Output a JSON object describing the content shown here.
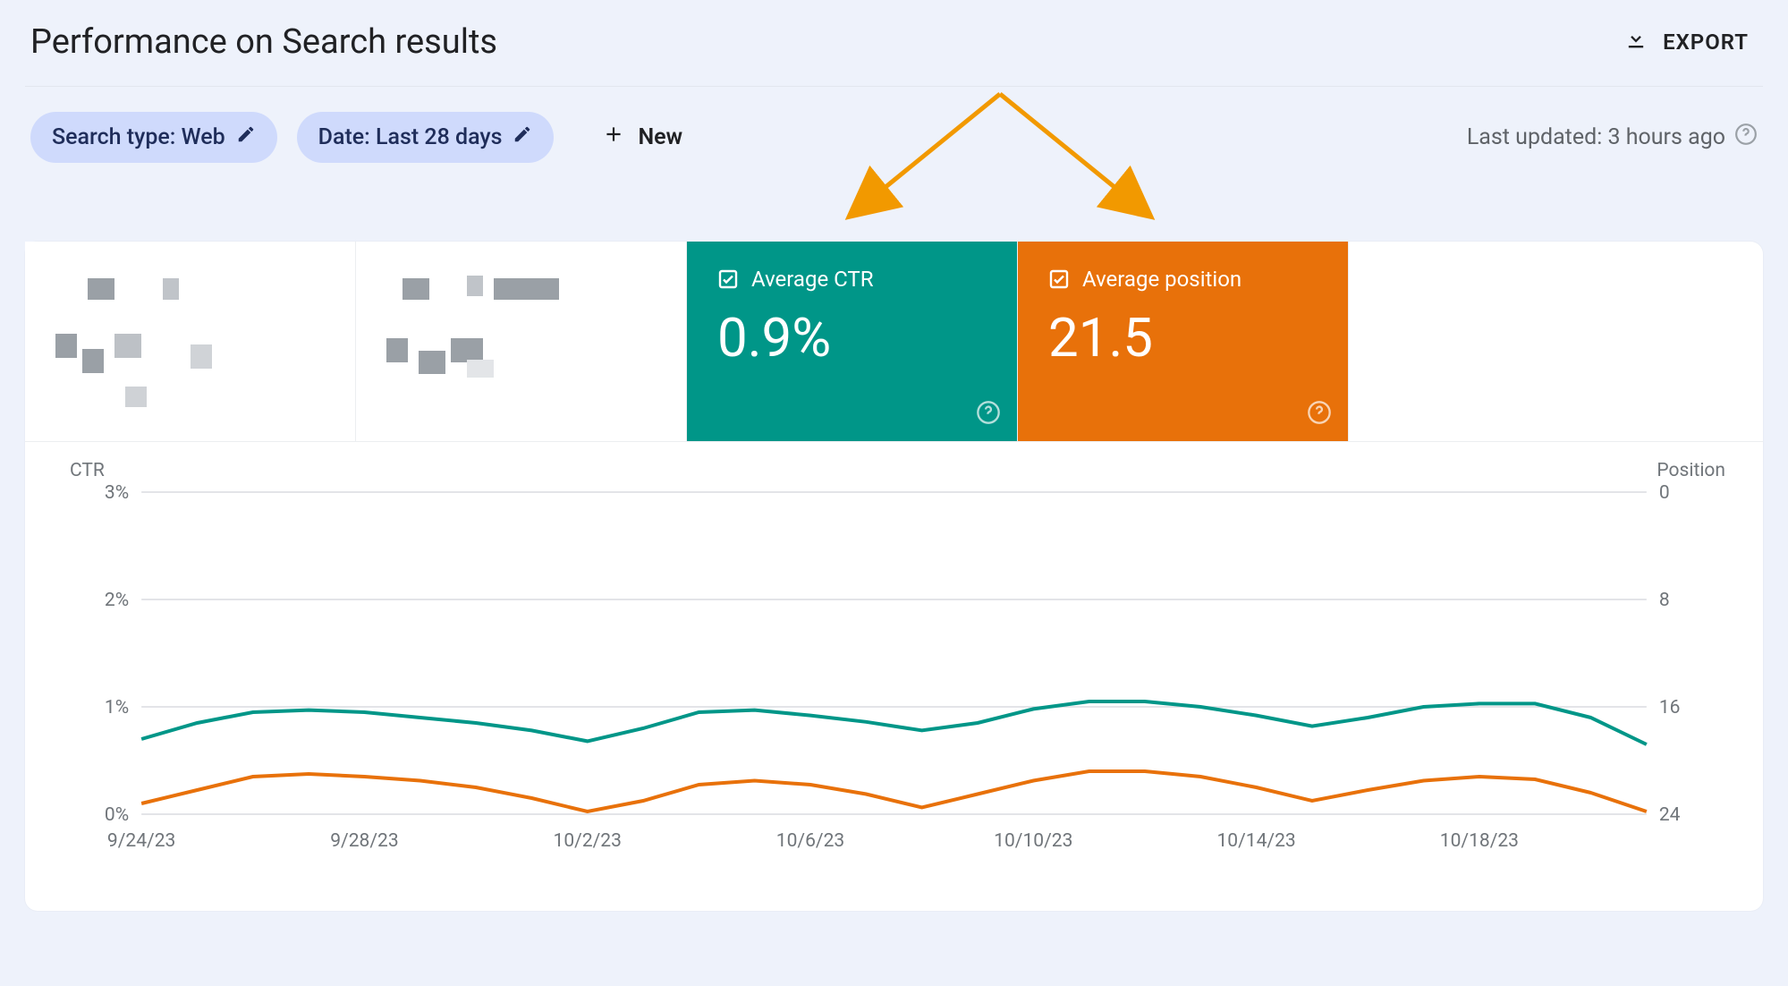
{
  "header": {
    "title": "Performance on Search results",
    "export_label": "EXPORT"
  },
  "filters": {
    "search_type_label": "Search type: Web",
    "date_label": "Date: Last 28 days",
    "new_label": "New",
    "last_updated_label": "Last updated: 3 hours ago"
  },
  "metrics": {
    "ctr_label": "Average CTR",
    "ctr_value": "0.9%",
    "position_label": "Average position",
    "position_value": "21.5"
  },
  "chart_axes": {
    "left_title": "CTR",
    "right_title": "Position"
  },
  "chart_data": {
    "type": "line",
    "x": [
      "9/24/23",
      "9/25/23",
      "9/26/23",
      "9/27/23",
      "9/28/23",
      "9/29/23",
      "9/30/23",
      "10/1/23",
      "10/2/23",
      "10/3/23",
      "10/4/23",
      "10/5/23",
      "10/6/23",
      "10/7/23",
      "10/8/23",
      "10/9/23",
      "10/10/23",
      "10/11/23",
      "10/12/23",
      "10/13/23",
      "10/14/23",
      "10/15/23",
      "10/16/23",
      "10/17/23",
      "10/18/23",
      "10/19/23",
      "10/20/23",
      "10/21/23"
    ],
    "x_tick_labels": [
      "9/24/23",
      "9/28/23",
      "10/2/23",
      "10/6/23",
      "10/10/23",
      "10/14/23",
      "10/18/23"
    ],
    "series": [
      {
        "name": "Average CTR",
        "axis": "left",
        "color": "#009688",
        "values": [
          0.7,
          0.85,
          0.95,
          0.97,
          0.95,
          0.9,
          0.85,
          0.78,
          0.68,
          0.8,
          0.95,
          0.97,
          0.92,
          0.86,
          0.78,
          0.85,
          0.98,
          1.05,
          1.05,
          1.0,
          0.92,
          0.82,
          0.9,
          1.0,
          1.03,
          1.03,
          0.9,
          0.65
        ]
      },
      {
        "name": "Average position",
        "axis": "right",
        "color": "#e8710a",
        "values": [
          23.2,
          22.2,
          21.2,
          21.0,
          21.2,
          21.5,
          22.0,
          22.8,
          23.8,
          23.0,
          21.8,
          21.5,
          21.8,
          22.5,
          23.5,
          22.5,
          21.5,
          20.8,
          20.8,
          21.2,
          22.0,
          23.0,
          22.2,
          21.5,
          21.2,
          21.4,
          22.4,
          23.8
        ]
      }
    ],
    "y_left": {
      "label": "CTR",
      "ticks": [
        "0%",
        "1%",
        "2%",
        "3%"
      ],
      "min": 0,
      "max": 3
    },
    "y_right": {
      "label": "Position",
      "ticks": [
        "24",
        "16",
        "8",
        "0"
      ],
      "min": 24,
      "max": 0
    }
  }
}
